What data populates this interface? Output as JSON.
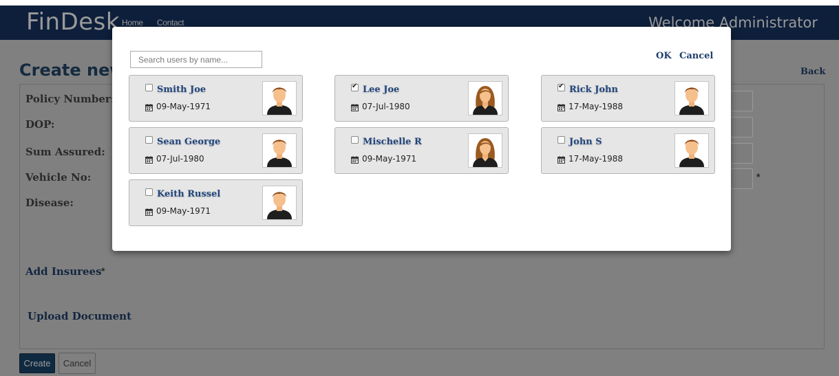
{
  "header": {
    "brand": "FinDesk",
    "nav": [
      "Home",
      "Contact"
    ],
    "welcome": "Welcome Administrator"
  },
  "page": {
    "heading": "Create new",
    "back": "Back",
    "fields": [
      "Policy Number:",
      "DOP:",
      "Sum Assured:",
      "Vehicle No:",
      "Disease:"
    ],
    "required_mark": "*",
    "add_insurees": "Add Insurees",
    "upload_document": "Upload Document",
    "create": "Create",
    "cancel": "Cancel"
  },
  "modal": {
    "search_placeholder": "Search users by name...",
    "ok": "OK",
    "cancel": "Cancel",
    "users": [
      {
        "name": "Smith Joe",
        "dob": "09-May-1971",
        "checked": false,
        "avatar": "male-avatar-icon"
      },
      {
        "name": "Lee Joe",
        "dob": "07-Jul-1980",
        "checked": true,
        "avatar": "female-avatar-icon"
      },
      {
        "name": "Rick John",
        "dob": "17-May-1988",
        "checked": true,
        "avatar": "male-avatar-icon"
      },
      {
        "name": "Sean George",
        "dob": "07-Jul-1980",
        "checked": false,
        "avatar": "male-avatar-icon"
      },
      {
        "name": "Mischelle R",
        "dob": "09-May-1971",
        "checked": false,
        "avatar": "female-avatar-icon"
      },
      {
        "name": "John S",
        "dob": "17-May-1988",
        "checked": false,
        "avatar": "male-avatar-icon"
      },
      {
        "name": "Keith Russel",
        "dob": "09-May-1971",
        "checked": false,
        "avatar": "male-avatar-icon"
      }
    ]
  },
  "colors": {
    "navbar": "#0e1f3b",
    "link": "#22467c",
    "card_bg": "#e6e6e6",
    "overlay": "#808080"
  }
}
